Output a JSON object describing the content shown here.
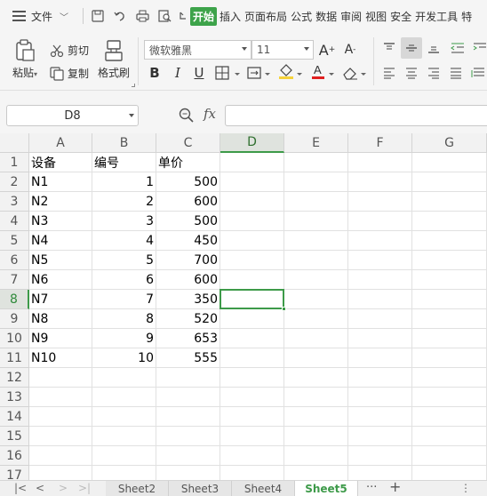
{
  "menu": {
    "file_label": "文件",
    "tabs": [
      "开始",
      "插入",
      "页面布局",
      "公式",
      "数据",
      "审阅",
      "视图",
      "安全",
      "开发工具",
      "特"
    ],
    "active_tab": "开始"
  },
  "ribbon": {
    "paste_label": "粘贴",
    "cut_label": "剪切",
    "copy_label": "复制",
    "format_painter_label": "格式刷",
    "font_name": "微软雅黑",
    "font_size": "11",
    "bold": "B",
    "italic": "I",
    "underline": "U",
    "font_color": "#e02020",
    "fill_color": "#f5d23a"
  },
  "formula_bar": {
    "name_box": "D8",
    "fx_label": "fx",
    "formula": ""
  },
  "grid": {
    "columns": [
      "A",
      "B",
      "C",
      "D",
      "E",
      "F",
      "G"
    ],
    "rows": [
      "1",
      "2",
      "3",
      "4",
      "5",
      "6",
      "7",
      "8",
      "9",
      "10",
      "11",
      "12",
      "13",
      "14",
      "15",
      "16",
      "17"
    ],
    "selected_column": "D",
    "selected_row": "8",
    "active_cell": "D8",
    "data": [
      {
        "a": "设备",
        "b": "编号",
        "c": "单价"
      },
      {
        "a": "N1",
        "b": "1",
        "c": "500"
      },
      {
        "a": "N2",
        "b": "2",
        "c": "600"
      },
      {
        "a": "N3",
        "b": "3",
        "c": "500"
      },
      {
        "a": "N4",
        "b": "4",
        "c": "450"
      },
      {
        "a": "N5",
        "b": "5",
        "c": "700"
      },
      {
        "a": "N6",
        "b": "6",
        "c": "600"
      },
      {
        "a": "N7",
        "b": "7",
        "c": "350"
      },
      {
        "a": "N8",
        "b": "8",
        "c": "520"
      },
      {
        "a": "N9",
        "b": "9",
        "c": "653"
      },
      {
        "a": "N10",
        "b": "10",
        "c": "555"
      }
    ]
  },
  "sheets": {
    "tabs": [
      "Sheet2",
      "Sheet3",
      "Sheet4",
      "Sheet5"
    ],
    "active": "Sheet5",
    "more_label": "···",
    "add_label": "+"
  },
  "colors": {
    "accent": "#3da34a"
  }
}
